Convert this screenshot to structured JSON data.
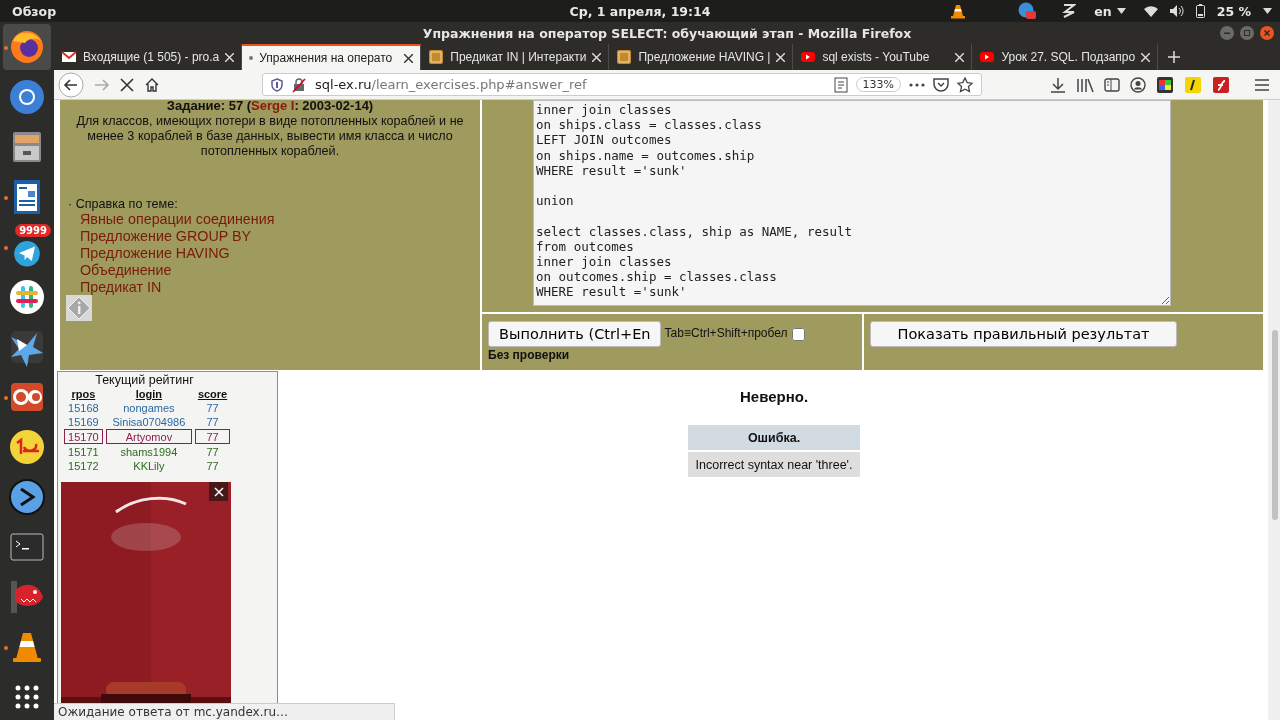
{
  "top_bar": {
    "activities": "Обзор",
    "clock": "Ср, 1 апреля, 19:14",
    "language": "en",
    "battery": "25 %"
  },
  "dock": [
    {
      "kind": "firefox",
      "running": true,
      "selected": true
    },
    {
      "kind": "chromium",
      "running": false,
      "selected": false
    },
    {
      "kind": "files",
      "running": false,
      "selected": false
    },
    {
      "kind": "writer",
      "running": true,
      "selected": false
    },
    {
      "kind": "telegram",
      "running": true,
      "selected": false,
      "badge": "9999"
    },
    {
      "kind": "slack",
      "running": false,
      "selected": false
    },
    {
      "kind": "stellarium",
      "running": false,
      "selected": false
    },
    {
      "kind": "docs",
      "running": true,
      "selected": false
    },
    {
      "kind": "onec",
      "running": false,
      "selected": false
    },
    {
      "kind": "zoom",
      "running": false,
      "selected": false
    },
    {
      "kind": "terminal",
      "running": false,
      "selected": false
    },
    {
      "kind": "game",
      "running": false,
      "selected": false
    },
    {
      "kind": "vlc",
      "running": true,
      "selected": false
    },
    {
      "kind": "apps",
      "running": false,
      "selected": false
    }
  ],
  "window": {
    "title": "Упражнения на оператор SELECT: обучающий этап - Mozilla Firefox"
  },
  "tabs": [
    {
      "label": "Входящие (1 505) - pro.a",
      "kind": "mail",
      "selected": false,
      "loading": false
    },
    {
      "label": "Упражнения на операто",
      "kind": "page",
      "selected": true,
      "loading": true
    },
    {
      "label": "Предикат IN | Интеракти",
      "kind": "site",
      "selected": false,
      "loading": false
    },
    {
      "label": "Предложение HAVING |",
      "kind": "site",
      "selected": false,
      "loading": false
    },
    {
      "label": "sql exists - YouTube",
      "kind": "video",
      "selected": false,
      "loading": false
    },
    {
      "label": "Урок 27. SQL. Подзапро",
      "kind": "video",
      "selected": false,
      "loading": false
    }
  ],
  "nav": {
    "can_go_forward": false
  },
  "address_bar": {
    "host": "sql-ex.ru",
    "path": "/learn_exercises.php#answer_ref",
    "zoom": "133%"
  },
  "task": {
    "prefix": "Задание: 57 (",
    "author": "Serge I",
    "suffix": ": 2003-02-14)",
    "description": "Для классов, имеющих потери в виде потопленных кораблей и не менее 3 кораблей в базе данных, вывести имя класса и число потопленных кораблей."
  },
  "help": {
    "title": "· Справка по теме:",
    "links": [
      "Явные операции соединения",
      "Предложение GROUP BY",
      "Предложение HAVING",
      "Объединение",
      "Предикат IN"
    ]
  },
  "editor": {
    "code": "inner join classes\non ships.class = classes.class\nLEFT JOIN outcomes\non ships.name = outcomes.ship\nWHERE result ='sunk'\n\nunion\n\nselect classes.class, ship as NAME, result\nfrom outcomes\ninner join classes\non outcomes.ship = classes.class\nWHERE result ='sunk'"
  },
  "controls": {
    "run_button": "Выполнить (Ctrl+En",
    "hint": "Tab≡Ctrl+Shift+пробел",
    "no_check_label": "Без проверки",
    "no_check_checked": false,
    "show_result_button": "Показать правильный результат"
  },
  "rating": {
    "title": "Текущий рейтинг",
    "columns": [
      "rpos",
      "login",
      "score"
    ],
    "rows": [
      {
        "cells": [
          "15168",
          "nongames",
          "77"
        ],
        "color": "#2b68a5",
        "selected": false
      },
      {
        "cells": [
          "15169",
          "Sinisa0704986",
          "77"
        ],
        "color": "#2b68a5",
        "selected": false
      },
      {
        "cells": [
          "15170",
          "Artyomov",
          "77"
        ],
        "color": "#8a2050",
        "selected": true
      },
      {
        "cells": [
          "15171",
          "shams1994",
          "77"
        ],
        "color": "#2e6b22",
        "selected": false
      },
      {
        "cells": [
          "15172",
          "KKLily",
          "77"
        ],
        "color": "#2e6b22",
        "selected": false
      }
    ]
  },
  "result": {
    "verdict": "Неверно.",
    "error_title": "Ошибка.",
    "error_text": "Incorrect syntax near 'three'."
  },
  "status_text": "Ожидание ответа от mc.yandex.ru…"
}
